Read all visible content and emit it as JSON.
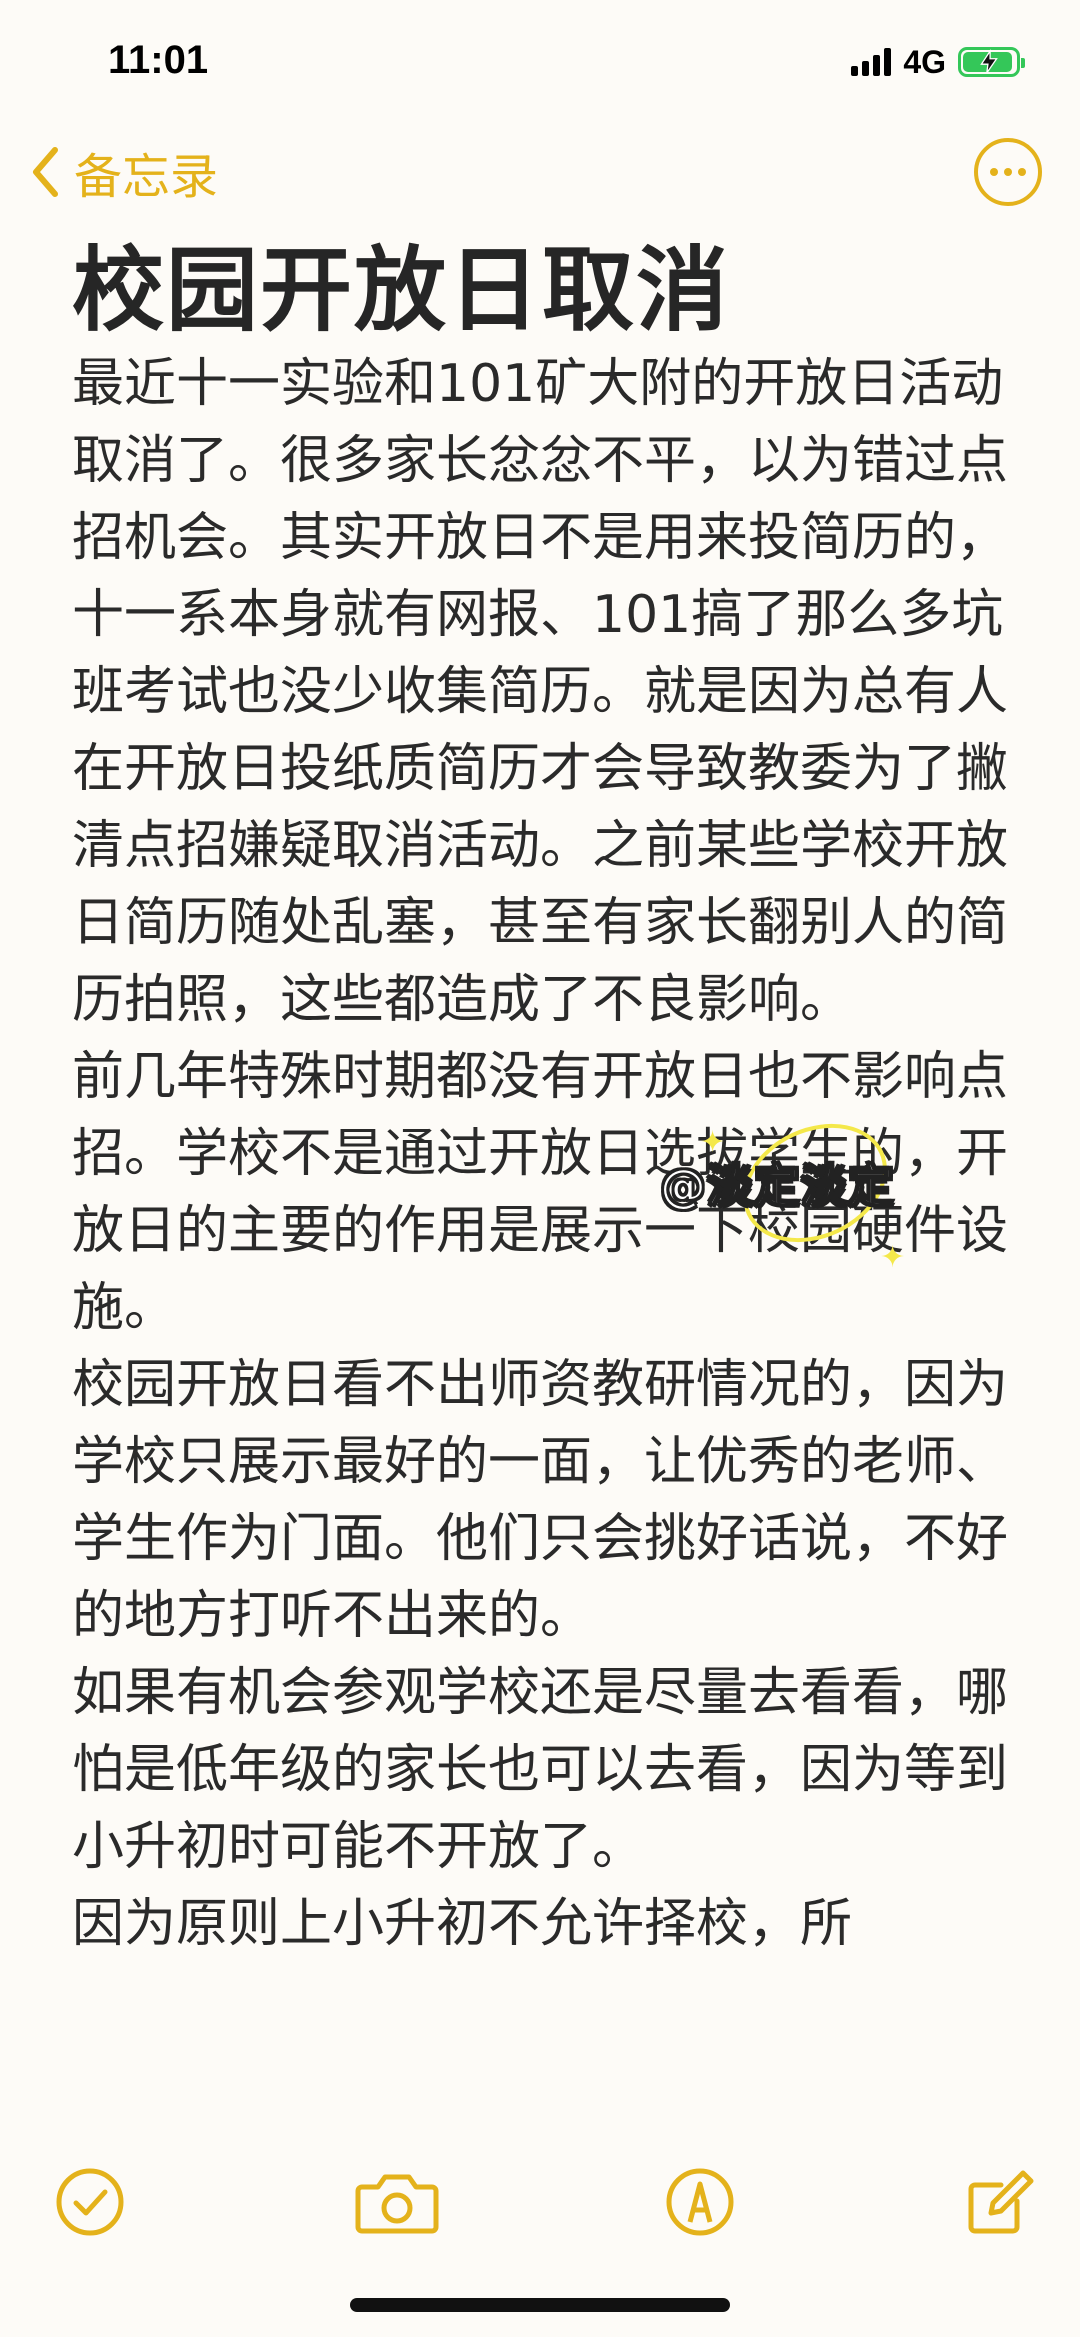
{
  "status_bar": {
    "time": "11:01",
    "network": "4G",
    "battery_level": 0.95,
    "battery_charging": true
  },
  "nav": {
    "back_label": "备忘录",
    "more_icon": "ellipsis-circle-icon"
  },
  "note": {
    "title": "校园开放日取消",
    "paragraphs": [
      "最近十一实验和101矿大附的开放日活动取消了。很多家长忿忿不平，以为错过点招机会。其实开放日不是用来投简历的，十一系本身就有网报、101搞了那么多坑班考试也没少收集简历。就是因为总有人在开放日投纸质简历才会导致教委为了撇清点招嫌疑取消活动。之前某些学校开放日简历随处乱塞，甚至有家长翻别人的简历拍照，这些都造成了不良影响。",
      "前几年特殊时期都没有开放日也不影响点招。学校不是通过开放日选拔学生的，开放日的主要的作用是展示一下校园硬件设施。",
      "校园开放日看不出师资教研情况的，因为学校只展示最好的一面，让优秀的老师、学生作为门面。他们只会挑好话说，不好的地方打听不出来的。",
      "如果有机会参观学校还是尽量去看看，哪怕是低年级的家长也可以去看，因为等到小升初时可能不开放了。",
      "因为原则上小升初不允许择校，所"
    ]
  },
  "watermark": {
    "text": "@淡定淡定"
  },
  "toolbar": {
    "checklist_icon": "checklist-icon",
    "camera_icon": "camera-icon",
    "markup_icon": "pen-markup-icon",
    "compose_icon": "compose-icon"
  },
  "colors": {
    "accent": "#e4b21b",
    "background": "#fdfbf7",
    "text": "#2a2a2a",
    "battery": "#34c759"
  }
}
